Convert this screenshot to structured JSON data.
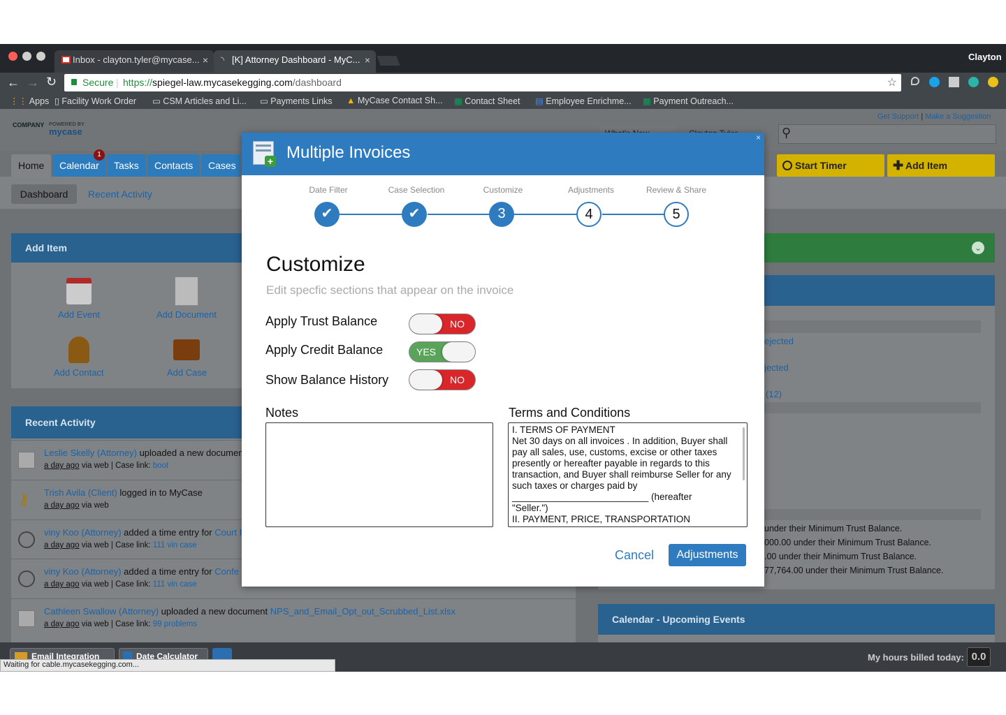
{
  "browser": {
    "tabs": [
      {
        "label": "Inbox - clayton.tyler@mycase..."
      },
      {
        "label": "[K] Attorney Dashboard - MyC..."
      }
    ],
    "profile": "Clayton",
    "secure_label": "Secure",
    "url_scheme": "https://",
    "url_host": "spiegel-law.mycasekegging.com",
    "url_path": "/dashboard",
    "bookmarks": [
      "Apps",
      "Facility Work Order",
      "CSM Articles and Li...",
      "Payments Links",
      "MyCase Contact Sh...",
      "Contact Sheet",
      "Employee Enrichme...",
      "Payment Outreach..."
    ]
  },
  "app": {
    "logo_company": "COMPANY",
    "logo_powered": "POWERED BY",
    "logo_brand": "mycase",
    "top_links": {
      "support": "Get Support",
      "sep": "|",
      "suggest": "Make a Suggestion"
    },
    "whats_new": "What's New",
    "user_menu": "Clayton Tyler",
    "nav_tabs": [
      "Home",
      "Calendar",
      "Tasks",
      "Contacts",
      "Cases"
    ],
    "calendar_badge": "1",
    "start_timer": "Start Timer",
    "add_item_btn": "Add Item",
    "subnav": [
      "Dashboard",
      "Recent Activity"
    ],
    "add_item_panel": {
      "title": "Add Item",
      "items": [
        "Add Event",
        "Add Document",
        "Add Contact",
        "Add Case"
      ]
    },
    "recent_activity": {
      "title": "Recent Activity",
      "rows": [
        {
          "who": "Leslie Skelly (Attorney)",
          "action": " uploaded a new documen",
          "time": "a day ago",
          "via": " via web | Case link: ",
          "case": "boot"
        },
        {
          "who": "Trish Avila (Client)",
          "action": " logged in to MyCase",
          "time": "a day ago",
          "via": " via web",
          "case": ""
        },
        {
          "who": "viny Koo (Attorney)",
          "action": " added a time entry for ",
          "link": "Court I",
          "time": "a day ago",
          "via": " via web | Case link: ",
          "case": "111 vin case"
        },
        {
          "who": "viny Koo (Attorney)",
          "action": " added a time entry for ",
          "link": "Confe",
          "time": "a day ago",
          "via": " via web | Case link: ",
          "case": "111 vin case"
        },
        {
          "who": "Cathleen Swallow (Attorney)",
          "action": " uploaded a new document ",
          "link": "NPS_and_Email_Opt_out_Scrubbed_List.xlsx",
          "time": "a day ago",
          "via": " via web | Case link: ",
          "case": "99 problems"
        }
      ]
    },
    "right_links": [
      "ejected",
      "jected",
      "(12)"
    ],
    "trust_lines": [
      "under their Minimum Trust Balance.",
      "000.00 under their Minimum Trust Balance.",
      ".00 under their Minimum Trust Balance.",
      "77,764.00 under their Minimum Trust Balance."
    ],
    "calendar_panel": "Calendar - Upcoming Events",
    "footer": {
      "email": "Email Integration",
      "date": "Date Calculator",
      "hours_label": "My hours billed today:",
      "hours_value": "0.0"
    },
    "status": "Waiting for cable.mycasekegging.com..."
  },
  "modal": {
    "title": "Multiple Invoices",
    "close": "×",
    "steps": [
      {
        "label": "Date Filter",
        "state": "done",
        "num": "1"
      },
      {
        "label": "Case Selection",
        "state": "done",
        "num": "2"
      },
      {
        "label": "Customize",
        "state": "current",
        "num": "3"
      },
      {
        "label": "Adjustments",
        "state": "todo",
        "num": "4"
      },
      {
        "label": "Review & Share",
        "state": "todo",
        "num": "5"
      }
    ],
    "heading": "Customize",
    "subheading": "Edit specfic sections that appear on the invoice",
    "options": [
      {
        "label": "Apply Trust Balance",
        "value": "NO"
      },
      {
        "label": "Apply Credit Balance",
        "value": "YES"
      },
      {
        "label": "Show Balance History",
        "value": "NO"
      }
    ],
    "notes_label": "Notes",
    "notes_value": "",
    "terms_label": "Terms and Conditions",
    "terms_lines": [
      "I. TERMS OF PAYMENT",
      "Net 30 days on all invoices . In addition, Buyer shall",
      "pay all sales, use, customs, excise or other taxes",
      "presently or hereafter payable in regards to this",
      "transaction, and Buyer shall reimburse Seller for any",
      "such taxes or charges paid by",
      "__________________________ (hereafter",
      "\"Seller.\")",
      "II. PAYMENT, PRICE, TRANSPORTATION"
    ],
    "cancel": "Cancel",
    "next": "Adjustments"
  },
  "colors": {
    "accent": "#2f7bbf",
    "on": "#5aa35a",
    "off": "#d9262b"
  }
}
